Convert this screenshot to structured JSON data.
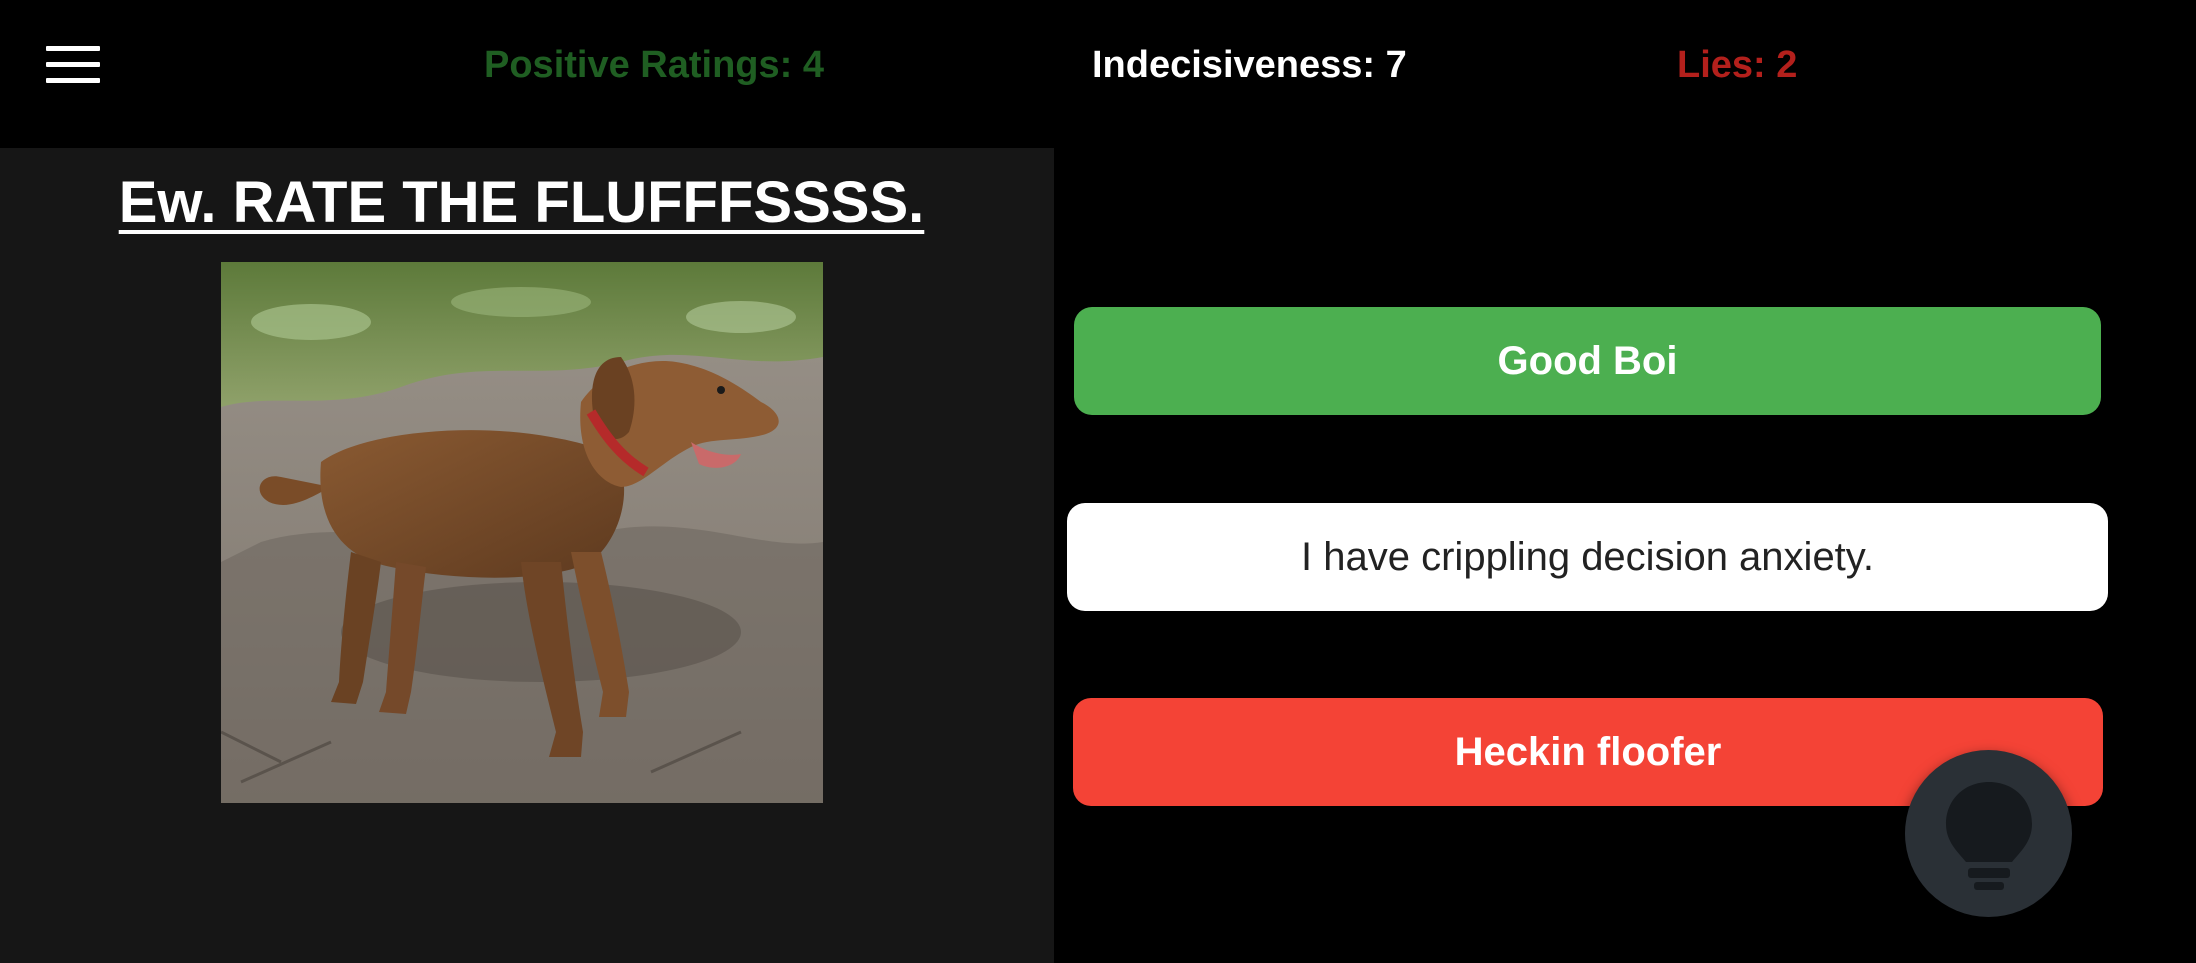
{
  "header": {
    "menu_icon": "hamburger-menu-icon",
    "positive_ratings": "Positive Ratings: 4",
    "indecisiveness": "Indecisiveness: 7",
    "lies": "Lies: 2",
    "colors": {
      "positive": "#1f5e22",
      "indecisive": "#ffffff",
      "lies": "#b3201c"
    }
  },
  "prompt": {
    "title": "Ew. RATE THE FLUFFFSSSS.",
    "image_subject": "dog-photo"
  },
  "answers": [
    {
      "label": "Good Boi",
      "color": "#4caf50"
    },
    {
      "label": "I have crippling decision anxiety.",
      "color": "#ffffff"
    },
    {
      "label": "Heckin floofer",
      "color": "#f44336"
    }
  ],
  "hint_button": {
    "icon": "lightbulb-icon",
    "color": "#2a3036"
  }
}
